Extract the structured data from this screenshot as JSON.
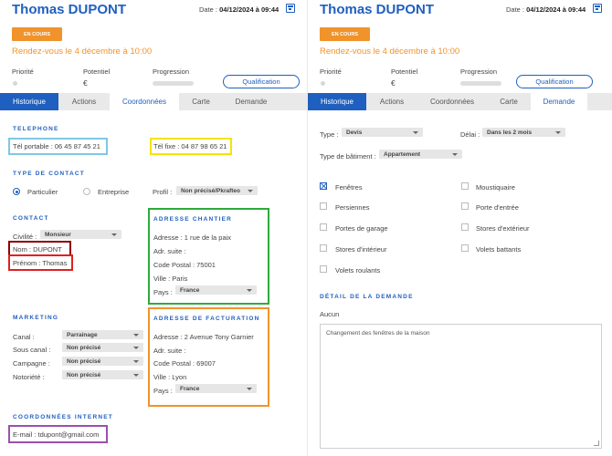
{
  "left": {
    "name": "Thomas DUPONT",
    "date_label": "Date :",
    "date_value": "04/12/2024 à 09:44",
    "status": "EN COURS",
    "rdv": "Rendez-vous le 4 décembre à 10:00",
    "priorite": "Priorité",
    "potentiel": "Potentiel",
    "euro": "€",
    "progression": "Progression",
    "qualification": "Qualification",
    "tabs": [
      "Historique",
      "Actions",
      "Coordonnées",
      "Carte",
      "Demande"
    ],
    "telephone": {
      "title": "TELEPHONE",
      "portable": "Tél portable : 06 45 87 45 21",
      "fixe": "Tél fixe : 04 87 98 65 21"
    },
    "type_contact": {
      "title": "TYPE DE CONTACT",
      "particulier": "Particulier",
      "entreprise": "Entreprise",
      "profil_label": "Profil :",
      "profil_value": "Non précisé/Pkrafteo"
    },
    "contact": {
      "title": "CONTACT",
      "civilite_label": "Civilité :",
      "civilite_value": "Monsieur",
      "nom": "Nom : DUPONT",
      "prenom": "Prénom : Thomas"
    },
    "chantier": {
      "title": "ADRESSE CHANTIER",
      "adresse": "Adresse : 1 rue de la paix",
      "suite": "Adr. suite :",
      "cp": "Code Postal : 75001",
      "ville": "Ville : Paris",
      "pays_label": "Pays :",
      "pays_value": "France"
    },
    "marketing": {
      "title": "MARKETING",
      "rows": [
        {
          "label": "Canal :",
          "value": "Parrainage"
        },
        {
          "label": "Sous canal :",
          "value": "Non précisé"
        },
        {
          "label": "Campagne :",
          "value": "Non précisé"
        },
        {
          "label": "Notoriété :",
          "value": "Non précisé"
        }
      ]
    },
    "facturation": {
      "title": "ADRESSE DE FACTURATION",
      "adresse": "Adresse : 2 Avenue Tony Garnier",
      "suite": "Adr. suite :",
      "cp": "Code Postal : 69007",
      "ville": "Ville : Lyon",
      "pays_label": "Pays :",
      "pays_value": "France"
    },
    "internet": {
      "title": "COORDONNÉES INTERNET",
      "email": "E-mail : tdupont@gmail.com"
    }
  },
  "right": {
    "name": "Thomas DUPONT",
    "date_label": "Date :",
    "date_value": "04/12/2024 à 09:44",
    "status": "EN COURS",
    "rdv": "Rendez-vous le 4 décembre à 10:00",
    "priorite": "Priorité",
    "potentiel": "Potentiel",
    "euro": "€",
    "progression": "Progression",
    "qualification": "Qualification",
    "tabs": [
      "Historique",
      "Actions",
      "Coordonnées",
      "Carte",
      "Demande"
    ],
    "type_label": "Type :",
    "type_value": "Devis",
    "delai_label": "Délai :",
    "delai_value": "Dans les 2 mois",
    "batiment_label": "Type de bâtiment :",
    "batiment_value": "Appartement",
    "checks": [
      {
        "label": "Fenêtres",
        "checked": true
      },
      {
        "label": "Moustiquaire",
        "checked": false
      },
      {
        "label": "Persiennes",
        "checked": false
      },
      {
        "label": "Porte d'entrée",
        "checked": false
      },
      {
        "label": "Portes de garage",
        "checked": false
      },
      {
        "label": "Stores d'extérieur",
        "checked": false
      },
      {
        "label": "Stores d'intérieur",
        "checked": false
      },
      {
        "label": "Volets battants",
        "checked": false
      },
      {
        "label": "Volets roulants",
        "checked": false
      }
    ],
    "detail_title": "DÉTAIL DE LA DEMANDE",
    "detail_aucun": "Aucun",
    "detail_text": "Changement des fenêtres de la maison"
  },
  "colors": {
    "primary": "#1f5fbf",
    "orange": "#f0932b",
    "box_portable": "#7ec8e3",
    "box_fixe": "#f5e400",
    "box_nom": "#8b0000",
    "box_prenom": "#e02020",
    "box_chantier": "#2eaa3c",
    "box_facturation": "#f0932b",
    "box_email": "#9b4fb0"
  }
}
